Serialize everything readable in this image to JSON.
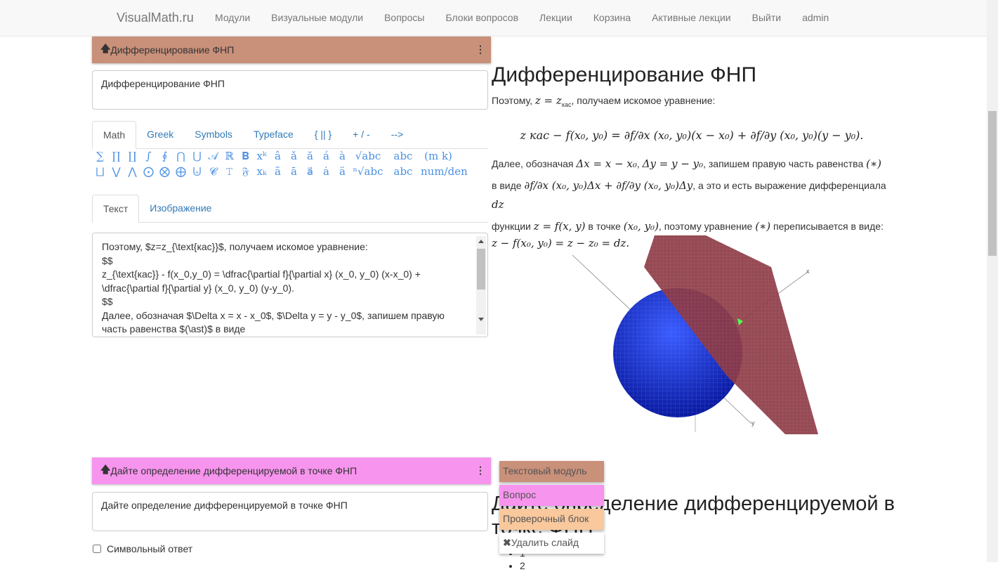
{
  "navbar": {
    "brand": "VisualMath.ru",
    "items": [
      "Модули",
      "Визуальные модули",
      "Вопросы",
      "Блоки вопросов",
      "Лекции",
      "Корзина",
      "Активные лекции",
      "Выйти",
      "admin"
    ]
  },
  "slide1": {
    "header": "Дифференцирование ФНП",
    "header_color": "#c9907a",
    "title_value": "Дифференцирование ФНП",
    "editor_tabs": [
      "Math",
      "Greek",
      "Symbols",
      "Typeface",
      "{ || }",
      "+ / -",
      "-->"
    ],
    "symbols_row1": [
      "∑",
      "∏",
      "∐",
      "∫",
      "∮",
      "⋂",
      "⋃",
      "𝒜",
      "ℝ",
      "𝐁",
      "xᵏ",
      "â",
      "ǎ",
      "ă",
      "á",
      "à",
      "√abc",
      "abc",
      "(m k)"
    ],
    "symbols_row2": [
      "⨆",
      "⋁",
      "⋀",
      "⨀",
      "⨂",
      "⨁",
      "⨄",
      "𝓒",
      "𝚃",
      "𝔉",
      "xₖ",
      "ã",
      "ā",
      "a⃗",
      "ȧ",
      "ä",
      "ⁿ√abc",
      "abc",
      "num/den"
    ],
    "content_tabs": [
      "Текст",
      "Изображение"
    ],
    "editor_lines": [
      "Поэтому, $z=z_{\\text{кас}}$, получаем искомое уравнение:",
      "$$",
      "z_{\\text{кас}} - f(x_0,y_0) = \\dfrac{\\partial f}{\\partial x} (x_0, y_0) (x-x_0) +",
      "\\dfrac{\\partial f}{\\partial y} (x_0, y_0) (y-y_0).",
      "$$",
      "Далее, обозначая $\\Delta x = x - x_0$, $\\Delta y = y - y_0$, запишем правую",
      "часть равенства $(\\ast)$ в виде"
    ]
  },
  "preview1": {
    "title": "Дифференцирование ФНП",
    "p1a": "Поэтому, ",
    "p1m": "z = z",
    "p1sub": "кас",
    "p1b": ", получаем искомое уравнение:",
    "eq": "z кас − f(x₀, y₀) = ∂f/∂x (x₀, y₀)(x − x₀) + ∂f/∂y (x₀, y₀)(y − y₀).",
    "p2a": "Далее, обозначая ",
    "p2m1": "Δx = x − x₀",
    "p2m2": "Δy = y − y₀",
    "p2b": ", запишем правую часть равенства ",
    "ast": "(∗)",
    "p3a": "в виде ",
    "p3m": "∂f/∂x (x₀, y₀)Δx + ∂f/∂y (x₀, y₀)Δy",
    "p3b": ", а это и есть выражение дифференциала ",
    "dz": "dz",
    "p4a": "функции ",
    "p4m1": "z = f(x, y)",
    "p4b": " в точке ",
    "p4m2": "(x₀, y₀)",
    "p4c": ", поэтому уравнение ",
    "p4d": " переписывается в виде:",
    "p5m": "z − f(x₀, y₀) = z − z₀ = dz.",
    "axis_x": "x",
    "axis_y": "y"
  },
  "slide2": {
    "header": "Дайте определение дифференцируемой в точке ФНП",
    "header_color": "#f794ee",
    "title_value": "Дайте определение дифференцируемой в точке ФНП",
    "checkbox_label": "Символьный ответ",
    "checkbox_checked": false
  },
  "preview2": {
    "title": "Дайте определение дифференцируемой в точке ФНП",
    "list": [
      "1",
      "2"
    ]
  },
  "add_menu": [
    {
      "label": "Текстовый модуль",
      "color": "#c9907a"
    },
    {
      "label": "Вопрос",
      "color": "#f794ee"
    },
    {
      "label": "Проверочный блок",
      "color": "#f9c89c"
    },
    {
      "label": "Удалить слайд",
      "color": "#ffffff",
      "icon": "close-icon"
    }
  ]
}
